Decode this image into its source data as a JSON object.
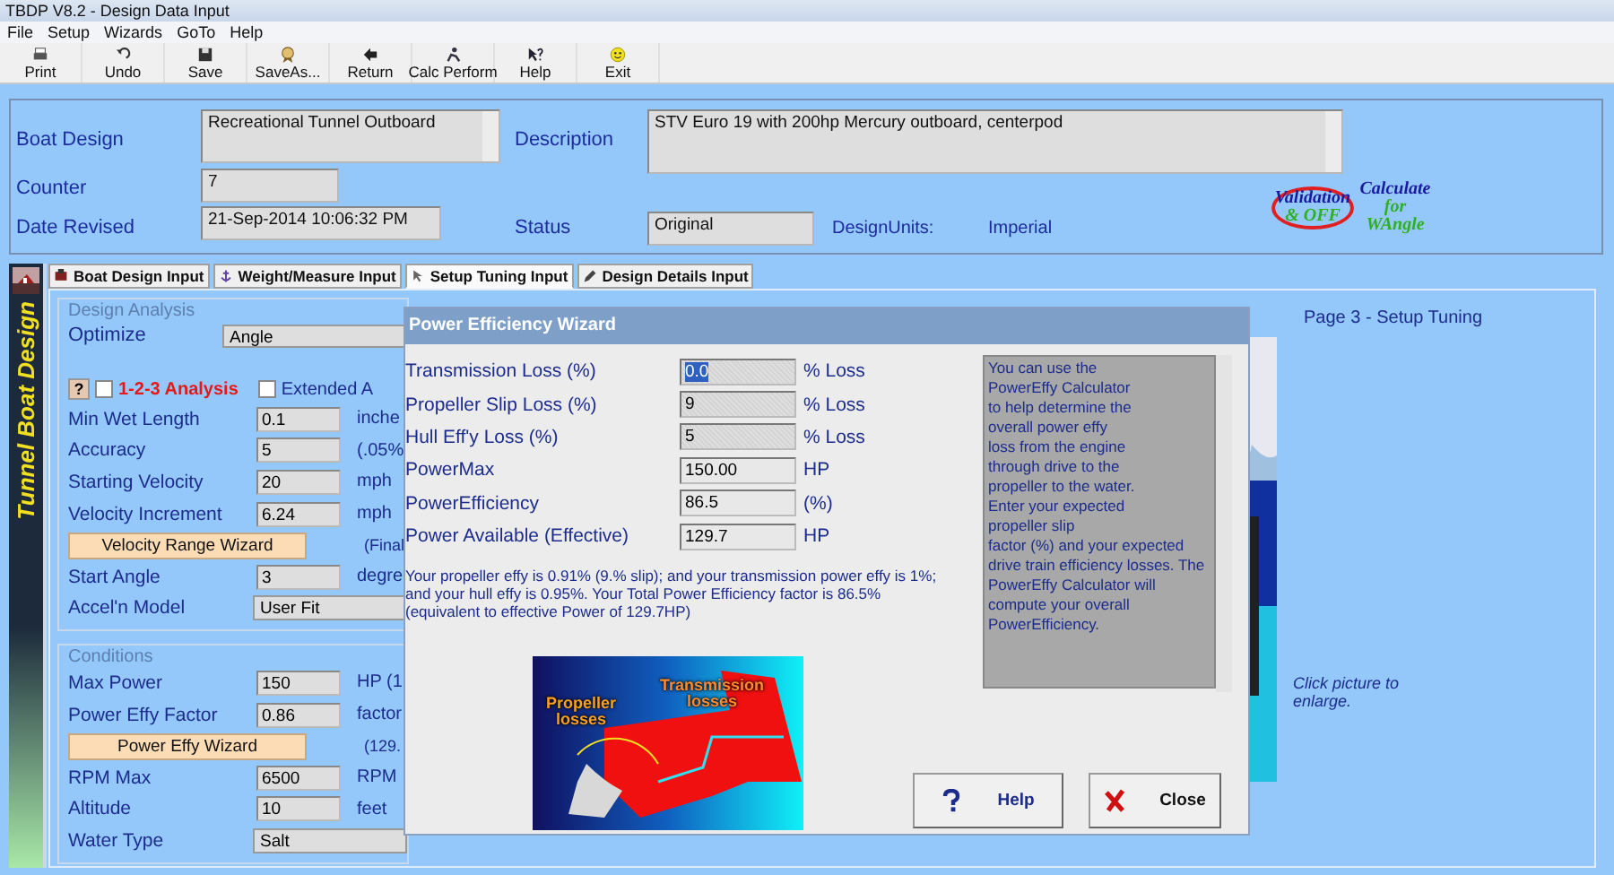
{
  "window": {
    "title": "TBDP V8.2 - Design Data Input"
  },
  "menu": [
    {
      "label": "File"
    },
    {
      "label": "Setup"
    },
    {
      "label": "Wizards"
    },
    {
      "label": "GoTo"
    },
    {
      "label": "Help"
    }
  ],
  "toolbar": [
    {
      "label": "Print",
      "kind": "print"
    },
    {
      "label": "Undo",
      "kind": "undo"
    },
    {
      "label": "Save",
      "kind": "save"
    },
    {
      "label": "SaveAs...",
      "kind": "saveas"
    },
    {
      "label": "Return",
      "kind": "return"
    },
    {
      "label": "Calc Perform",
      "kind": "calc"
    },
    {
      "label": "Help",
      "kind": "help"
    },
    {
      "label": "Exit",
      "kind": "exit"
    }
  ],
  "header": {
    "boat_design": {
      "label": "Boat Design",
      "value": "Recreational Tunnel Outboard"
    },
    "description": {
      "label": "Description",
      "value": "STV Euro 19 with 200hp Mercury outboard, centerpod"
    },
    "counter": {
      "label": "Counter",
      "value": "7"
    },
    "date_revised": {
      "label": "Date Revised",
      "value": "21-Sep-2014 10:06:32 PM"
    },
    "status": {
      "label": "Status",
      "value": "Original"
    },
    "design_units": {
      "label": "DesignUnits:",
      "value": "Imperial"
    },
    "actions": [
      {
        "kind": "validation",
        "lines": [
          "Validation",
          "& OFF"
        ]
      },
      {
        "kind": "calculate",
        "lines": [
          "Calculate",
          "for",
          "WAngle"
        ]
      }
    ]
  },
  "side_banner": {
    "title": "Tunnel Boat Design"
  },
  "tabs": [
    {
      "label": "Boat Design Input",
      "selected": false,
      "kind": "boat"
    },
    {
      "label": "Weight/Measure Input",
      "selected": false,
      "kind": "scale"
    },
    {
      "label": "Setup Tuning Input",
      "selected": true,
      "kind": "tune"
    },
    {
      "label": "Design Details Input",
      "selected": false,
      "kind": "details"
    }
  ],
  "design_analysis": {
    "title": "Design Analysis",
    "optimize": {
      "label": "Optimize",
      "value": "Angle"
    },
    "help_button": "?",
    "checkboxes": [
      {
        "label": "1-2-3 Analysis",
        "checked": false,
        "kind": "highlight"
      },
      {
        "label": "Extended A",
        "checked": false,
        "kind": "plain"
      }
    ],
    "rows": [
      {
        "kind": "field",
        "label": "Min Wet Length",
        "value": "0.1",
        "unit": "inche"
      },
      {
        "kind": "field",
        "label": "Accuracy",
        "value": "5",
        "unit": "(.05%"
      },
      {
        "kind": "field",
        "label": "Starting Velocity",
        "value": "20",
        "unit": "mph"
      },
      {
        "kind": "field",
        "label": "Velocity Increment",
        "value": "6.24",
        "unit": "mph"
      },
      {
        "kind": "button",
        "label": "Velocity Range Wizard",
        "unit": "(Final"
      },
      {
        "kind": "field",
        "label": "Start Angle",
        "value": "3",
        "unit": "degre"
      },
      {
        "kind": "dropdown",
        "label": "Accel'n Model",
        "value": "User Fit"
      }
    ]
  },
  "conditions": {
    "title": "Conditions",
    "rows": [
      {
        "kind": "field",
        "label": "Max Power",
        "value": "150",
        "unit": "HP (1"
      },
      {
        "kind": "field",
        "label": "Power Effy Factor",
        "value": "0.86",
        "unit": "factor"
      },
      {
        "kind": "button",
        "label": "Power Effy Wizard",
        "unit": "(129."
      },
      {
        "kind": "field",
        "label": "RPM Max",
        "value": "6500",
        "unit": "RPM"
      },
      {
        "kind": "field",
        "label": "Altitude",
        "value": "10",
        "unit": "feet"
      },
      {
        "kind": "dropdown",
        "label": "Water Type",
        "value": "Salt"
      }
    ]
  },
  "page_title": "Page 3 - Setup Tuning",
  "picture_hint": "Click picture to enlarge.",
  "dialog": {
    "title": "Power Efficiency Wizard",
    "rows": [
      {
        "label": "Transmission Loss (%)",
        "value": "0.0",
        "unit": "% Loss",
        "kind": "input",
        "highlighted": true
      },
      {
        "label": "Propeller Slip Loss (%)",
        "value": "9",
        "unit": "% Loss",
        "kind": "input",
        "highlighted": false
      },
      {
        "label": "Hull Eff'y Loss (%)",
        "value": "5",
        "unit": "% Loss",
        "kind": "input",
        "highlighted": false
      },
      {
        "label": "PowerMax",
        "value": "150.00",
        "unit": "HP",
        "kind": "output",
        "highlighted": false
      },
      {
        "label": "PowerEfficiency",
        "value": "86.5",
        "unit": "(%)",
        "kind": "output",
        "highlighted": false
      },
      {
        "label": "Power Available (Effective)",
        "value": "129.7",
        "unit": "HP",
        "kind": "output",
        "highlighted": false
      }
    ],
    "summary": "Your propeller effy is 0.91% (9.% slip); and your transmission power effy is 1%; and your hull effy is 0.95%.  Your Total Power Efficiency factor is 86.5% (equivalent to effective Power of 129.7HP)",
    "diagram_labels": [
      {
        "kind": "propeller",
        "text": "Propeller losses"
      },
      {
        "kind": "transmission",
        "text": "Transmission losses"
      }
    ],
    "help_text": "You can use the\nPowerEffy Calculator\nto help determine the\noverall power effy\nloss from the engine\nthrough drive to the\npropeller to the water.\nEnter your expected\npropeller slip\nfactor (%) and your expected\ndrive train efficiency losses.  The\nPowerEffy Calculator will\ncompute your overall\nPowerEfficiency.",
    "buttons": [
      {
        "label": "Help",
        "kind": "help"
      },
      {
        "label": "Close",
        "kind": "close"
      }
    ]
  }
}
